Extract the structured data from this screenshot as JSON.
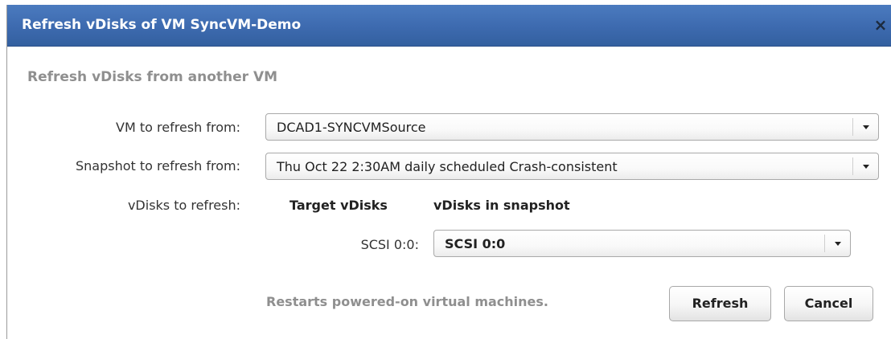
{
  "dialog": {
    "title": "Refresh vDisks of VM SyncVM-Demo",
    "close_label": "×"
  },
  "section": {
    "heading": "Refresh vDisks from another VM"
  },
  "form": {
    "vm_label": "VM to refresh from:",
    "vm_value": "DCAD1-SYNCVMSource",
    "snapshot_label": "Snapshot to refresh from:",
    "snapshot_value": "Thu Oct 22 2:30AM  daily scheduled  Crash-consistent",
    "vdisks_label": "vDisks to refresh:",
    "col_target": "Target vDisks",
    "col_snapshot": "vDisks in snapshot",
    "disk_rows": [
      {
        "target": "SCSI 0:0:",
        "snapshot_value": "SCSI 0:0"
      }
    ]
  },
  "footer": {
    "note": "Restarts powered-on virtual machines.",
    "refresh_label": "Refresh",
    "cancel_label": "Cancel"
  },
  "colors": {
    "titlebar": "#3d6aaf",
    "heading_gray": "#8f8f8f"
  }
}
